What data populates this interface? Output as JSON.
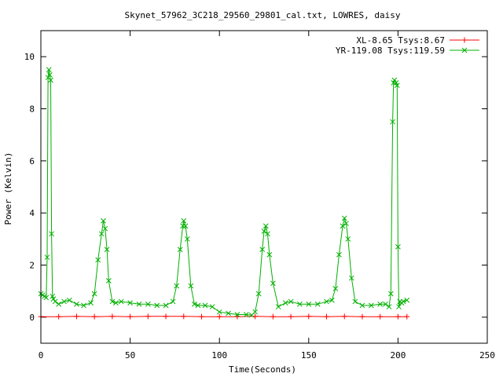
{
  "chart_data": {
    "type": "line",
    "title": "Skynet_57962_3C218_29560_29801_cal.txt, LOWRES, daisy",
    "xlabel": "Time(Seconds)",
    "ylabel": "Power (Kelvin)",
    "xlim": [
      0,
      250
    ],
    "ylim": [
      -1,
      11
    ],
    "xticks": [
      0,
      50,
      100,
      150,
      200,
      250
    ],
    "yticks": [
      0,
      2,
      4,
      6,
      8,
      10
    ],
    "grid": false,
    "legend_position": "top-right",
    "series": [
      {
        "name": "XL-8.65 Tsys:8.67",
        "color": "#ff0000",
        "marker": "plus",
        "x": [
          0,
          10,
          20,
          30,
          40,
          50,
          60,
          70,
          80,
          90,
          100,
          110,
          120,
          130,
          140,
          150,
          160,
          170,
          180,
          190,
          200,
          205
        ],
        "y": [
          0.02,
          0.02,
          0.03,
          0.02,
          0.03,
          0.02,
          0.03,
          0.03,
          0.03,
          0.02,
          0.02,
          0.02,
          0.03,
          0.02,
          0.02,
          0.03,
          0.02,
          0.03,
          0.02,
          0.02,
          0.02,
          0.02
        ]
      },
      {
        "name": "YR-119.08 Tsys:119.59",
        "color": "#00b000",
        "marker": "cross",
        "x": [
          0,
          1,
          2,
          3,
          3.5,
          4,
          4.5,
          5,
          5.5,
          6,
          6.5,
          7,
          8,
          10,
          13,
          16,
          20,
          24,
          28,
          30,
          32,
          34,
          35,
          36,
          37,
          38,
          40,
          42,
          45,
          50,
          55,
          60,
          65,
          70,
          74,
          76,
          78,
          79.5,
          80,
          81,
          82,
          84,
          86,
          88,
          92,
          96,
          100,
          105,
          110,
          115,
          118,
          120,
          122,
          124,
          125,
          126,
          127,
          128,
          130,
          133,
          137,
          140,
          145,
          150,
          155,
          160,
          163,
          165,
          167,
          169,
          170,
          171,
          172,
          174,
          176,
          180,
          185,
          190,
          193,
          195,
          196,
          197,
          197.5,
          198,
          199,
          199.5,
          200,
          200.5,
          201,
          202,
          203,
          205
        ],
        "y": [
          0.9,
          0.85,
          0.8,
          0.75,
          2.3,
          9.2,
          9.5,
          9.3,
          9.1,
          3.2,
          0.8,
          0.7,
          0.6,
          0.5,
          0.6,
          0.65,
          0.5,
          0.45,
          0.55,
          0.9,
          2.2,
          3.2,
          3.7,
          3.4,
          2.6,
          1.4,
          0.6,
          0.55,
          0.6,
          0.55,
          0.5,
          0.5,
          0.45,
          0.45,
          0.6,
          1.2,
          2.6,
          3.5,
          3.7,
          3.5,
          3.0,
          1.2,
          0.5,
          0.45,
          0.45,
          0.4,
          0.2,
          0.15,
          0.1,
          0.1,
          0.08,
          0.2,
          0.9,
          2.6,
          3.3,
          3.5,
          3.2,
          2.4,
          1.3,
          0.4,
          0.55,
          0.6,
          0.5,
          0.5,
          0.5,
          0.6,
          0.65,
          1.1,
          2.4,
          3.5,
          3.8,
          3.6,
          3.0,
          1.5,
          0.6,
          0.45,
          0.45,
          0.5,
          0.5,
          0.4,
          0.9,
          7.5,
          9.0,
          9.1,
          9.0,
          8.9,
          2.7,
          0.4,
          0.6,
          0.55,
          0.6,
          0.65
        ]
      }
    ]
  }
}
